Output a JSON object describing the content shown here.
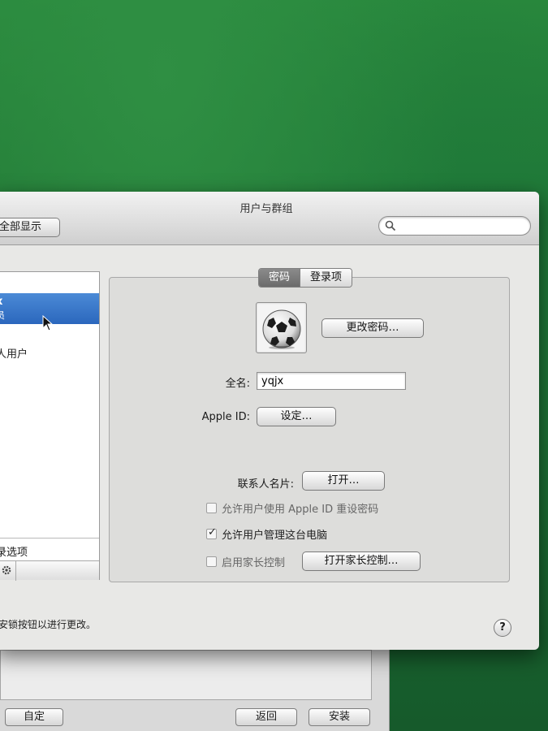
{
  "window": {
    "title": "用户与群组",
    "show_all_label": "全部显示",
    "search_placeholder": ""
  },
  "sidebar": {
    "selected_user_name": "x",
    "selected_user_role": "员",
    "other_user_label": "人用户",
    "other_user_sub": "Ⅱ",
    "login_options_label": "录选项"
  },
  "tabs": [
    {
      "label": "密码",
      "active": true
    },
    {
      "label": "登录项",
      "active": false
    }
  ],
  "account": {
    "change_password_label": "更改密码…",
    "full_name_label": "全名:",
    "full_name_value": "yqjx",
    "apple_id_label": "Apple ID:",
    "apple_id_button": "设定…",
    "contact_card_label": "联系人名片:",
    "contact_card_button": "打开…"
  },
  "options": [
    {
      "label": "允许用户使用 Apple ID 重设密码",
      "checked": false,
      "enabled": false
    },
    {
      "label": "允许用户管理这台电脑",
      "checked": true,
      "enabled": true
    },
    {
      "label": "启用家长控制",
      "checked": false,
      "enabled": false
    }
  ],
  "parental_controls_button": "打开家长控制…",
  "footer": {
    "lock_text": "安锁按钮以进行更改。",
    "help_label": "?"
  },
  "back_window": {
    "customize_label": "自定",
    "back_label": "返回",
    "install_label": "安装"
  }
}
